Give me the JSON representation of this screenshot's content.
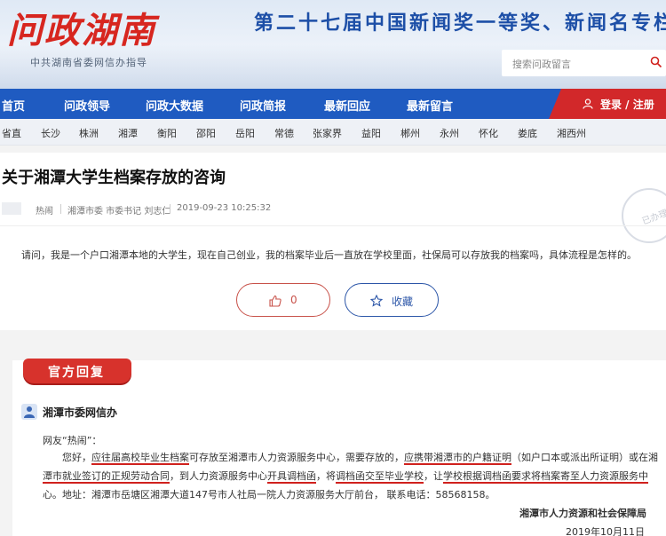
{
  "header": {
    "logo": "问政湖南",
    "guide": "中共湖南省委网信办指导",
    "slogan": "第二十七届中国新闻奖一等奖、新闻名专栏",
    "search_placeholder": "搜索问政留言"
  },
  "nav": {
    "items": [
      "首页",
      "问政领导",
      "问政大数据",
      "问政简报",
      "最新回应",
      "最新留言"
    ],
    "login": "登录 / 注册"
  },
  "regions": [
    "省直",
    "长沙",
    "株洲",
    "湘潭",
    "衡阳",
    "邵阳",
    "岳阳",
    "常德",
    "张家界",
    "益阳",
    "郴州",
    "永州",
    "怀化",
    "娄底",
    "湘西州"
  ],
  "post": {
    "title": "关于湘潭大学生档案存放的咨询",
    "author": "热闹",
    "target": "湘潭市委 市委书记 刘志仁",
    "time": "2019-09-23 10:25:32",
    "stamp": "已办理",
    "question": "请问，我是一个户口湘潭本地的大学生，现在自己创业，我的档案毕业后一直放在学校里面，社保局可以存放我的档案吗，具体流程是怎样的。",
    "likes": "0",
    "favorite": "收藏"
  },
  "reply": {
    "badge": "官方回复",
    "org": "湘潭市委网信办",
    "greeting": "网友“热闹”：",
    "segments": {
      "s1": "您好，",
      "u1": "应往届高校毕业生档案",
      "s2": "可存放至湘潭市人力资源服务中心，需要存放的，",
      "u2": "应携带湘潭市的户籍证明",
      "s3": "（如户口本或派出所证明）或在湘",
      "u3a": "潭市就业签订的正规劳动合同",
      "s4": "，到人力资源服务中心",
      "u4": "开具调档函",
      "s5": "，将",
      "u5": "调档函交至毕业学校",
      "s6": "，让",
      "u6": "学校根据调档函要求将档案寄至人力资源服务中",
      "s7": "心。地址：湘潭市岳塘区湘潭大道147号市人社局一院人力资源服务大厅前台，  联系电话：58568158。"
    },
    "signature": "湘潭市人力资源和社会保障局",
    "date": "2019年10月11日"
  },
  "colors": {
    "brand_red": "#d7261f",
    "nav_blue": "#1f5bc1",
    "underline_red": "#d0211d"
  }
}
